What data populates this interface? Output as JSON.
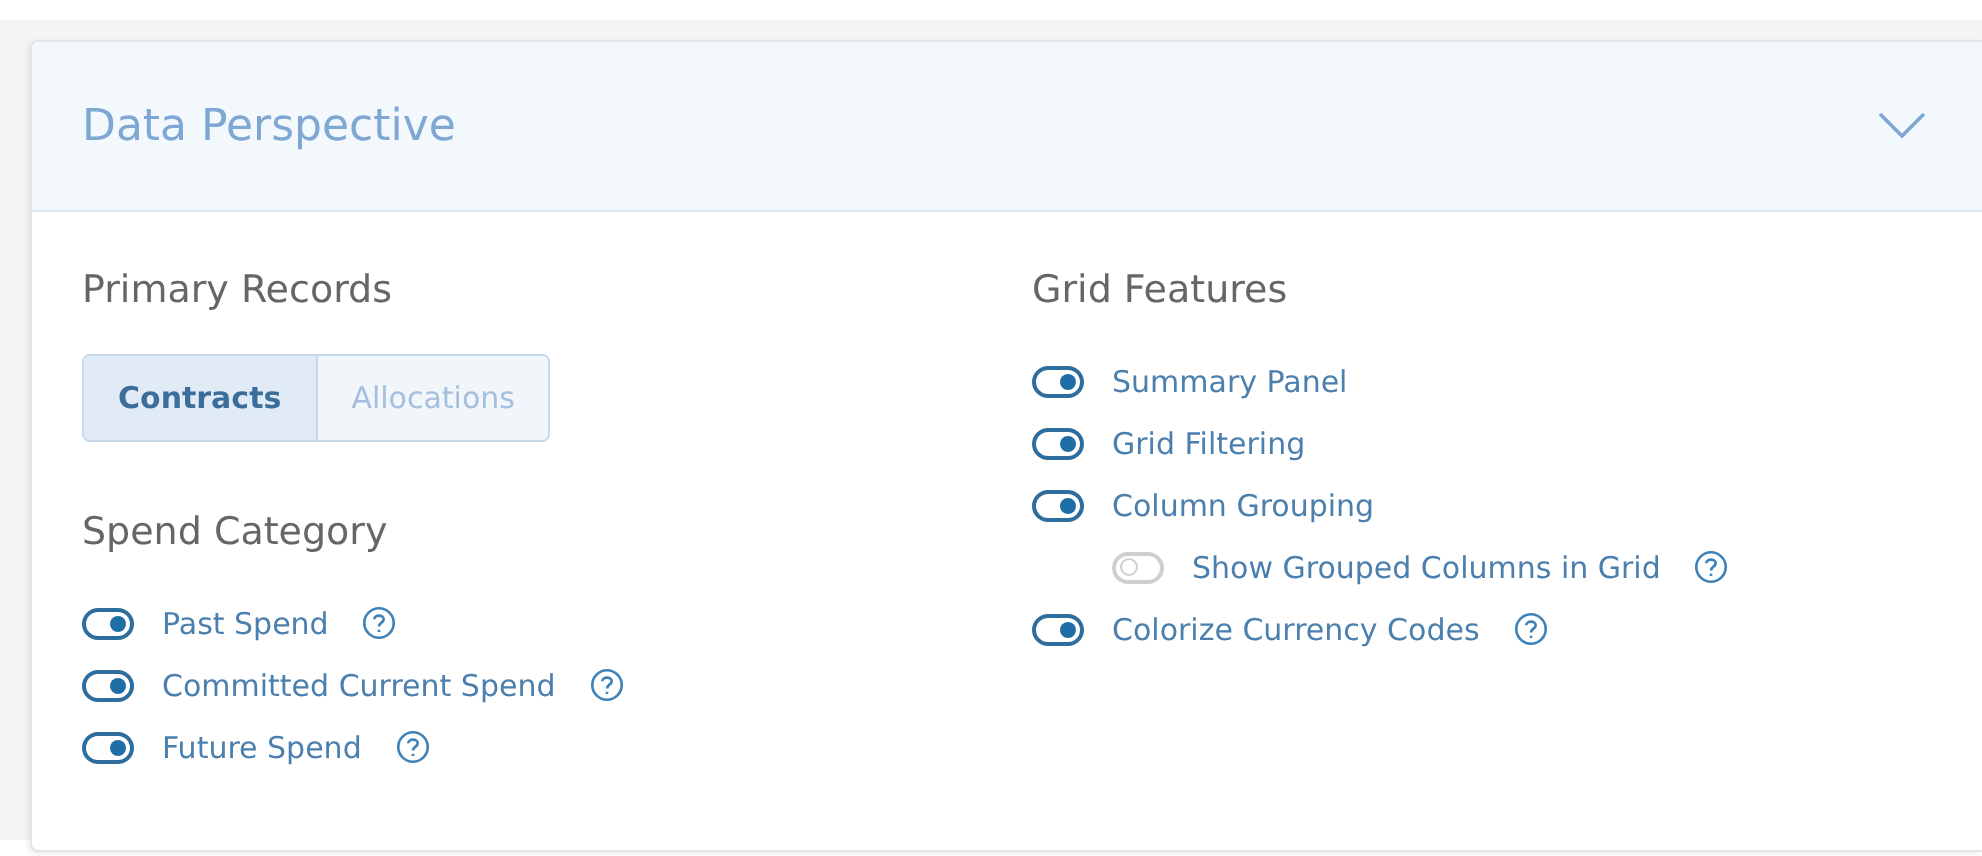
{
  "panel": {
    "title": "Data Perspective"
  },
  "primary_records": {
    "heading": "Primary Records",
    "options": [
      {
        "label": "Contracts",
        "selected": true
      },
      {
        "label": "Allocations",
        "selected": false
      }
    ]
  },
  "spend_category": {
    "heading": "Spend Category",
    "toggles": [
      {
        "label": "Past Spend",
        "on": true,
        "help": true
      },
      {
        "label": "Committed Current Spend",
        "on": true,
        "help": true
      },
      {
        "label": "Future Spend",
        "on": true,
        "help": true
      }
    ]
  },
  "grid_features": {
    "heading": "Grid Features",
    "toggles": [
      {
        "label": "Summary Panel",
        "on": true,
        "help": false
      },
      {
        "label": "Grid Filtering",
        "on": true,
        "help": false
      },
      {
        "label": "Column Grouping",
        "on": true,
        "help": false,
        "children": [
          {
            "label": "Show Grouped Columns in Grid",
            "on": false,
            "help": true
          }
        ]
      },
      {
        "label": "Colorize Currency Codes",
        "on": true,
        "help": true
      }
    ]
  }
}
